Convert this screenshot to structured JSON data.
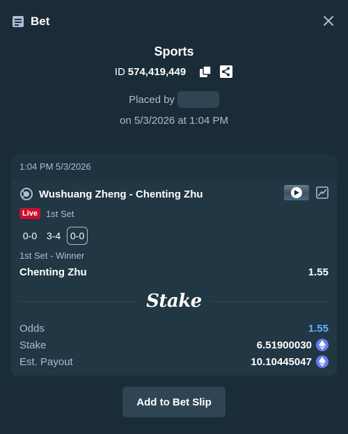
{
  "header": {
    "title": "Bet",
    "title_icon": "ticket-icon",
    "close_icon": "close-icon"
  },
  "summary": {
    "sport": "Sports",
    "id_label": "ID",
    "id_value": "574,419,449",
    "placed_by_label": "Placed by",
    "date_text": "on 5/3/2026 at 1:04 PM"
  },
  "card": {
    "timestamp": "1:04 PM 5/3/2026",
    "match_name": "Wushuang Zheng - Chenting Zhu",
    "live_label": "Live",
    "period": "1st Set",
    "scores": [
      "0-0",
      "3-4",
      "0-0"
    ],
    "market": "1st Set - Winner",
    "pick": "Chenting Zhu",
    "pick_odds": "1.55",
    "brand": "Stake",
    "totals": {
      "odds_label": "Odds",
      "odds_value": "1.55",
      "stake_label": "Stake",
      "stake_value": "6.51900030",
      "payout_label": "Est. Payout",
      "payout_value": "10.10445047"
    }
  },
  "actions": {
    "add_label": "Add to Bet Slip"
  },
  "colors": {
    "bg": "#1a2c38",
    "card": "#213743",
    "accent_blue": "#5bb2ff",
    "live_red": "#c8102e",
    "eth": "#627eea"
  }
}
